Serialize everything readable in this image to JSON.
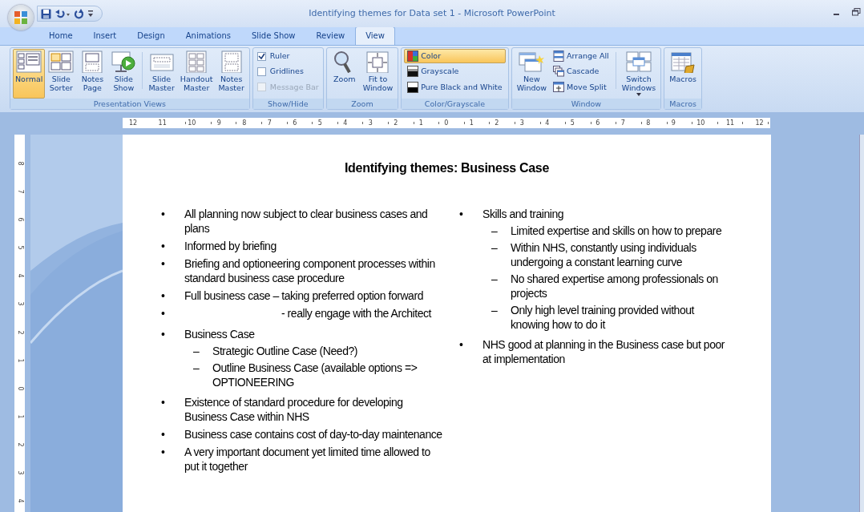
{
  "window": {
    "title": "Identifying themes for Data set 1 - Microsoft PowerPoint"
  },
  "tabs": [
    {
      "label": "Home",
      "selected": false
    },
    {
      "label": "Insert",
      "selected": false
    },
    {
      "label": "Design",
      "selected": false
    },
    {
      "label": "Animations",
      "selected": false
    },
    {
      "label": "Slide Show",
      "selected": false
    },
    {
      "label": "Review",
      "selected": false
    },
    {
      "label": "View",
      "selected": true
    }
  ],
  "ribbon": {
    "groups": [
      {
        "label": "Presentation Views",
        "items": [
          {
            "kind": "large",
            "label": "Normal",
            "selected": true
          },
          {
            "kind": "large",
            "label": "Slide\nSorter",
            "selected": false
          },
          {
            "kind": "large",
            "label": "Notes\nPage",
            "selected": false
          },
          {
            "kind": "large",
            "label": "Slide\nShow",
            "selected": false
          },
          {
            "kind": "separator"
          },
          {
            "kind": "large",
            "label": "Slide\nMaster",
            "selected": false
          },
          {
            "kind": "large",
            "label": "Handout\nMaster",
            "selected": false
          },
          {
            "kind": "large",
            "label": "Notes\nMaster",
            "selected": false
          }
        ]
      },
      {
        "label": "Show/Hide",
        "items": [
          {
            "kind": "check",
            "label": "Ruler",
            "checked": true,
            "disabled": false
          },
          {
            "kind": "check",
            "label": "Gridlines",
            "checked": false,
            "disabled": false
          },
          {
            "kind": "check",
            "label": "Message Bar",
            "checked": false,
            "disabled": true
          }
        ]
      },
      {
        "label": "Zoom",
        "items": [
          {
            "kind": "large",
            "label": "Zoom",
            "selected": false
          },
          {
            "kind": "large",
            "label": "Fit to\nWindow",
            "selected": false
          }
        ]
      },
      {
        "label": "Color/Grayscale",
        "items": [
          {
            "kind": "stack",
            "buttons": [
              {
                "label": "Color",
                "selected": true
              },
              {
                "label": "Grayscale",
                "selected": false
              },
              {
                "label": "Pure Black and White",
                "selected": false
              }
            ]
          }
        ]
      },
      {
        "label": "Window",
        "items": [
          {
            "kind": "large",
            "label": "New\nWindow",
            "selected": false
          },
          {
            "kind": "stack",
            "buttons": [
              {
                "label": "Arrange All",
                "selected": false
              },
              {
                "label": "Cascade",
                "selected": false
              },
              {
                "label": "Move Split",
                "selected": false
              }
            ]
          },
          {
            "kind": "separator"
          },
          {
            "kind": "large",
            "label": "Switch\nWindows",
            "selected": false,
            "dropdown": true
          }
        ]
      },
      {
        "label": "Macros",
        "items": [
          {
            "kind": "large",
            "label": "Macros",
            "selected": false
          }
        ]
      }
    ]
  },
  "rulers": {
    "horizontal": [
      "12",
      "11",
      "10",
      "9",
      "8",
      "7",
      "6",
      "5",
      "4",
      "3",
      "2",
      "1",
      "0",
      "1",
      "2",
      "3",
      "4",
      "5",
      "6",
      "7",
      "8",
      "9",
      "10",
      "11",
      "12"
    ],
    "vertical": [
      "8",
      "7",
      "6",
      "5",
      "4",
      "3",
      "2",
      "1",
      "0",
      "1",
      "2",
      "3",
      "4"
    ]
  },
  "slide": {
    "title": "Identifying themes: Business Case",
    "columns": [
      [
        {
          "kind": "bullet",
          "marker": "•",
          "text": "All planning now subject to clear business cases and plans"
        },
        {
          "kind": "bullet",
          "marker": "•",
          "text": "Informed by briefing"
        },
        {
          "kind": "bullet",
          "marker": "•",
          "text": "Briefing and optioneering component processes within standard business case procedure"
        },
        {
          "kind": "bullet",
          "marker": "•",
          "text": "Full business case – taking preferred option forward"
        },
        {
          "kind": "indented",
          "marker": "•",
          "text": "- really engage with the Architect"
        },
        {
          "kind": "bullet",
          "marker": "•",
          "text": "Business Case",
          "children": [
            {
              "marker": "–",
              "text": "Strategic Outline Case (Need?)"
            },
            {
              "marker": "–",
              "text": "Outline Business Case (available options  => OPTIONEERING"
            }
          ]
        },
        {
          "kind": "bullet",
          "marker": "•",
          "text": "Existence of standard procedure for developing Business Case within NHS"
        },
        {
          "kind": "bullet",
          "marker": "•",
          "text": "Business case contains cost of day-to-day maintenance"
        },
        {
          "kind": "bullet",
          "marker": "•",
          "text": "A very important document yet limited time allowed to put it together"
        }
      ],
      [
        {
          "kind": "bullet",
          "marker": "•",
          "text": "Skills and training",
          "children": [
            {
              "marker": "–",
              "text": "Limited expertise and skills on how to prepare"
            },
            {
              "marker": "–",
              "text": "Within NHS, constantly using individuals undergoing a constant learning curve"
            },
            {
              "marker": "–",
              "text": "No shared expertise among professionals on projects"
            },
            {
              "marker": "–",
              "text": "Only high level training provided without knowing how to do it"
            }
          ]
        },
        {
          "kind": "bullet",
          "marker": "•",
          "text": "NHS good at planning in the Business case but poor at implementation"
        }
      ]
    ]
  }
}
